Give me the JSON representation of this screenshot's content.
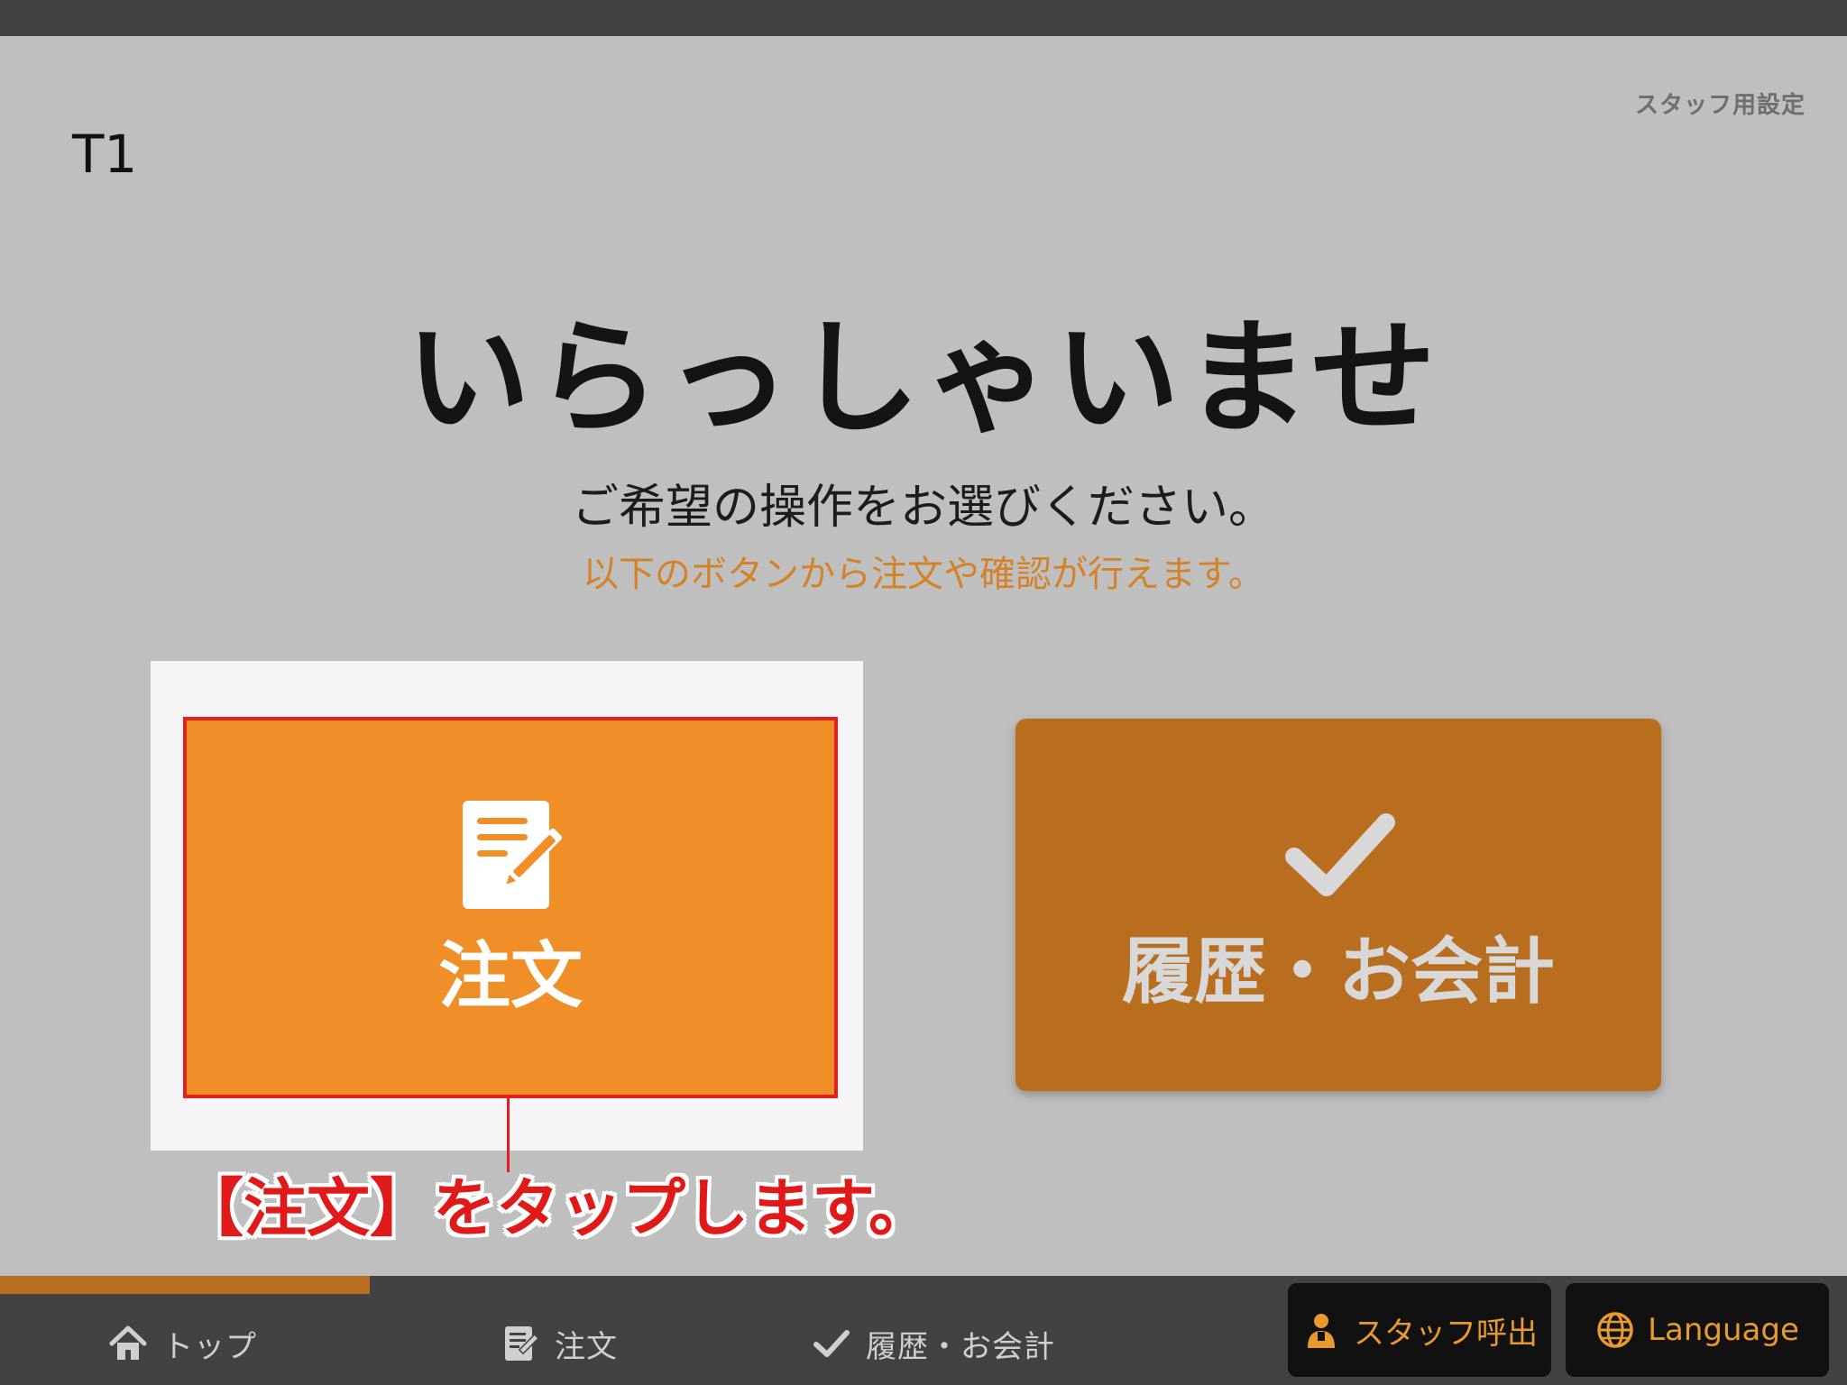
{
  "header": {
    "table_label": "T1",
    "staff_settings_label": "スタッフ用設定"
  },
  "welcome": {
    "title": "いらっしゃいませ",
    "subtitle": "ご希望の操作をお選びください。",
    "hint": "以下のボタンから注文や確認が行えます。"
  },
  "actions": {
    "order_label": "注文",
    "history_label": "履歴・お会計"
  },
  "annotation": {
    "callout": "【注文】をタップします。"
  },
  "bottom_nav": {
    "items": [
      {
        "label": "トップ",
        "icon": "home-icon"
      },
      {
        "label": "注文",
        "icon": "memo-icon"
      },
      {
        "label": "履歴・お会計",
        "icon": "check-icon"
      }
    ],
    "staff_call_label": "スタッフ呼出",
    "language_label": "Language",
    "active_index": 0
  },
  "colors": {
    "background": "#bfbfbf",
    "accent_orange": "#f08e27",
    "dark_orange": "#b86d1f",
    "highlight_red": "#e81d1d",
    "nav_background": "#424242"
  }
}
